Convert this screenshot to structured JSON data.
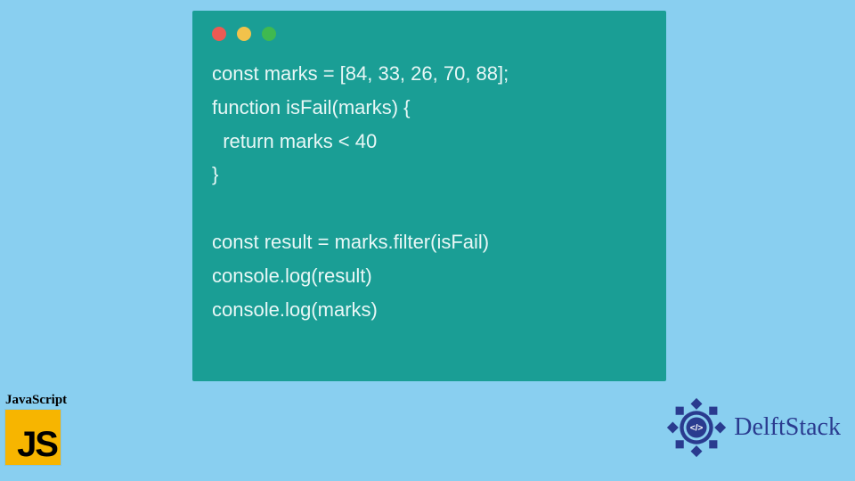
{
  "code_window": {
    "traffic_lights": [
      "red",
      "yellow",
      "green"
    ],
    "code_lines": [
      "const marks = [84, 33, 26, 70, 88];",
      "function isFail(marks) {",
      "  return marks < 40",
      "}",
      "",
      "const result = marks.filter(isFail)",
      "console.log(result)",
      "console.log(marks)"
    ]
  },
  "js_badge": {
    "label": "JavaScript",
    "monogram": "JS"
  },
  "brand": {
    "name": "DelftStack",
    "logo_icon": "code-brackets-emblem"
  },
  "colors": {
    "background": "#89cff0",
    "window_bg": "#1a9e95",
    "js_yellow": "#f7b500",
    "brand_blue": "#2a3b8f"
  }
}
